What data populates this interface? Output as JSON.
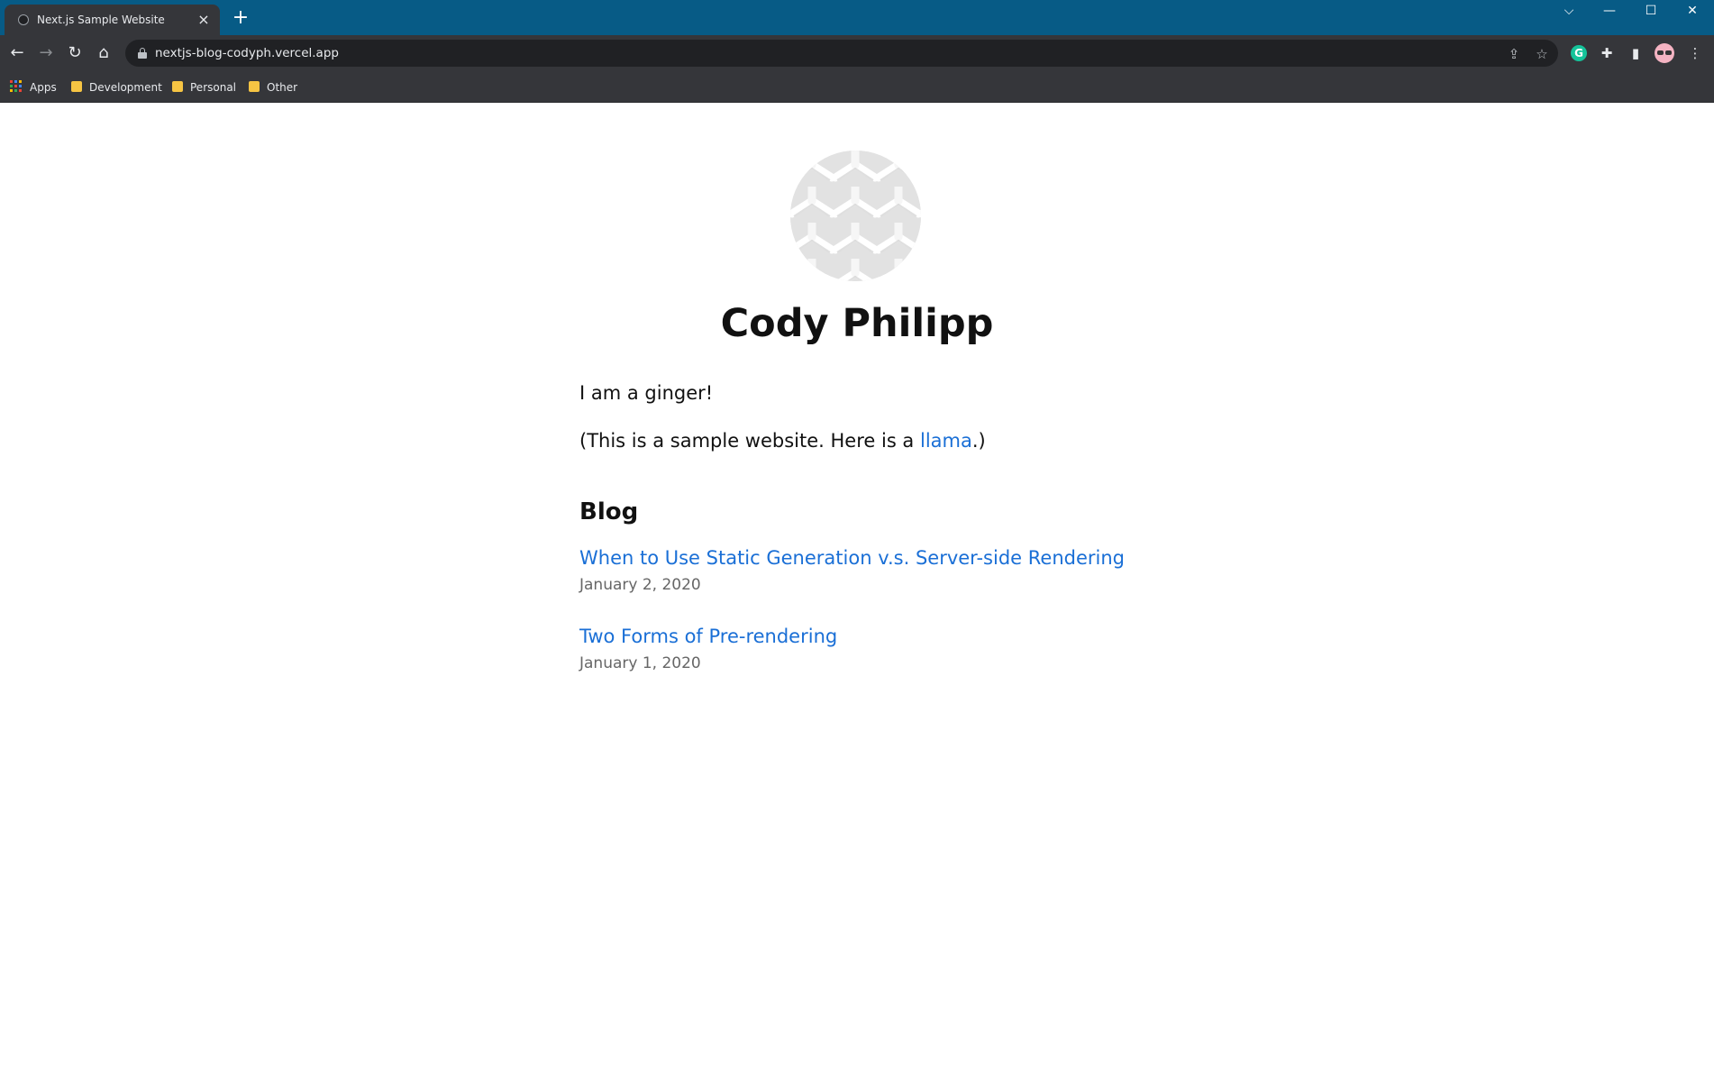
{
  "browser": {
    "tab": {
      "title": "Next.js Sample Website",
      "close": "×"
    },
    "new_tab": "+",
    "window_controls": {
      "tabsearch": "⌵",
      "minimize": "—",
      "maximize": "☐",
      "close": "✕"
    },
    "toolbar": {
      "back": "←",
      "forward": "→",
      "reload": "↻",
      "home": "⌂",
      "url": "nextjs-blog-codyph.vercel.app",
      "share": "⇪",
      "star": "☆",
      "extensions": [
        "grammarly-icon",
        "puzzle-icon",
        "sidepanel-icon",
        "avatar-icon"
      ],
      "grammarly_letter": "G",
      "puzzle": "✚",
      "sidepanel": "▮",
      "menu": "⋮"
    },
    "bookmarks": [
      {
        "label": "Apps",
        "icon": "apps-grid-icon"
      },
      {
        "label": "Development",
        "icon": "folder-icon"
      },
      {
        "label": "Personal",
        "icon": "folder-icon"
      },
      {
        "label": "Other",
        "icon": "folder-icon"
      }
    ]
  },
  "page": {
    "name": "Cody Philipp",
    "intro": "I am a ginger!",
    "intro2_before": "(This is a sample website. Here is a ",
    "intro2_link": "llama",
    "intro2_after": ".)",
    "blog_heading": "Blog",
    "posts": [
      {
        "title": "When to Use Static Generation v.s. Server-side Rendering",
        "date": "January 2, 2020"
      },
      {
        "title": "Two Forms of Pre-rendering",
        "date": "January 1, 2020"
      }
    ]
  },
  "colors": {
    "titlebar": "#075b86",
    "toolbar": "#35363a",
    "link": "#1a6fd6",
    "date": "#666666"
  }
}
